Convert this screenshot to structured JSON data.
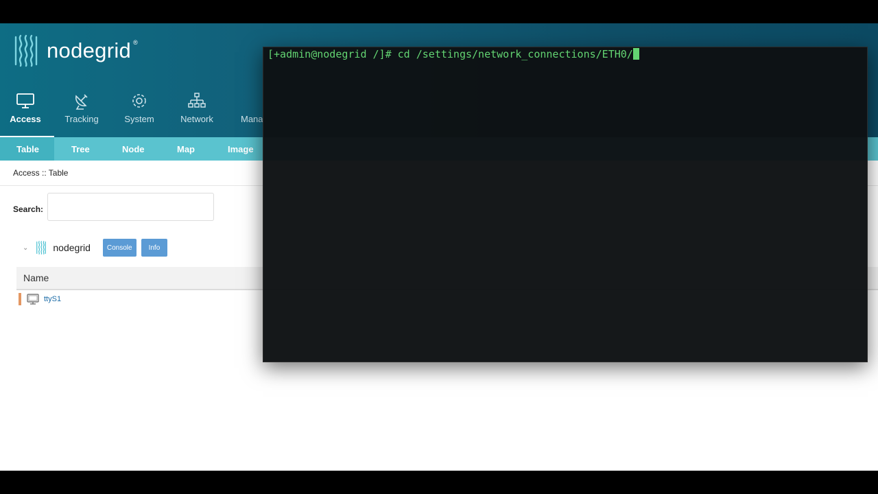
{
  "app": {
    "logo_text": "nodegrid",
    "logo_mark": "®"
  },
  "nav": {
    "items": [
      {
        "label": "Access",
        "icon": "monitor-icon"
      },
      {
        "label": "Tracking",
        "icon": "satellite-dish-icon"
      },
      {
        "label": "System",
        "icon": "gear-icon"
      },
      {
        "label": "Network",
        "icon": "network-icon"
      },
      {
        "label": "Mana",
        "icon": "manage-icon"
      }
    ],
    "active": "Access"
  },
  "subnav": {
    "items": [
      "Table",
      "Tree",
      "Node",
      "Map",
      "Image"
    ],
    "active": "Table"
  },
  "breadcrumb": "Access :: Table",
  "search": {
    "label": "Search:",
    "value": "",
    "placeholder": ""
  },
  "device": {
    "name": "nodegrid",
    "console_label": "Console",
    "info_label": "Info"
  },
  "table": {
    "columns": [
      "Name"
    ],
    "rows": [
      {
        "name": "ttyS1",
        "status_color": "#e39763"
      }
    ]
  },
  "terminal": {
    "command_line": "[+admin@nodegrid /]# cd /settings/network_connections/ETH0/"
  },
  "colors": {
    "header": "#0f5d77",
    "subnav": "#5ac3cf",
    "button": "#5b9bd5",
    "terminal_text": "#63d472",
    "terminal_bg": "#0d1113"
  }
}
